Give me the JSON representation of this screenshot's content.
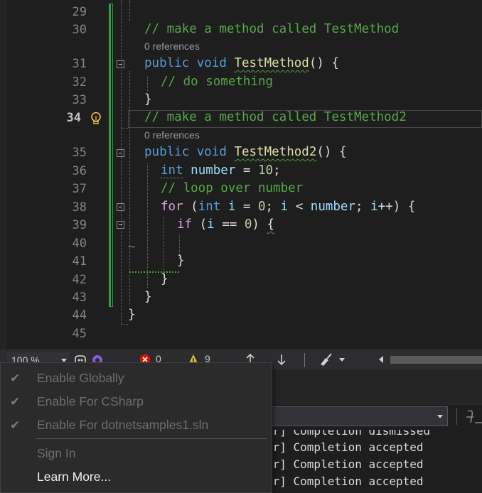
{
  "editor": {
    "line_numbers": [
      "29",
      "30",
      "31",
      "32",
      "33",
      "34",
      "35",
      "36",
      "37",
      "38",
      "39",
      "40",
      "41",
      "42",
      "43",
      "44",
      "45"
    ],
    "active_line": "34",
    "codelens": [
      "0 references",
      "0 references"
    ],
    "lines": {
      "l30": "// make a method called TestMethod",
      "l31_kw1": "public",
      "l31_kw2": "void",
      "l31_method": "TestMethod",
      "l31_rest": "() {",
      "l32": "// do something",
      "l33": "}",
      "l34": "// make a method called TestMethod2",
      "l35_kw1": "public",
      "l35_kw2": "void",
      "l35_method": "TestMethod2",
      "l35_rest": "() {",
      "l36_kw": "int",
      "l36_var": "number",
      "l36_op": " = ",
      "l36_num": "10",
      "l36_end": ";",
      "l37": "// loop over number",
      "l38_kw": "for",
      "l38_a": " (",
      "l38_int": "int",
      "l38_i": "i",
      "l38_b": " = ",
      "l38_zero": "0",
      "l38_c": "; ",
      "l38_i2": "i",
      "l38_d": " < ",
      "l38_number": "number",
      "l38_e": "; ",
      "l38_i3": "i",
      "l38_f": "++) {",
      "l39_kw": "if",
      "l39_a": " (",
      "l39_i": "i",
      "l39_b": " == ",
      "l39_zero": "0",
      "l39_c": ") ",
      "l39_brace": "{",
      "l40_tilde": "~",
      "l41": "}",
      "l42": "}",
      "l43": "}",
      "l44": "}"
    }
  },
  "statusbar": {
    "zoom": "100 %",
    "errors": "0",
    "warnings": "9"
  },
  "output": {
    "lines": [
      "er] Completion dismissed",
      "er] Completion accepted",
      "er] Completion accepted",
      "er] Completion accepted"
    ]
  },
  "context_menu": {
    "items": [
      {
        "label": "Enable Globally",
        "checked": true,
        "enabled": false
      },
      {
        "label": "Enable For CSharp",
        "checked": true,
        "enabled": false
      },
      {
        "label": "Enable For dotnetsamples1.sln",
        "checked": true,
        "enabled": false
      },
      {
        "label": "Sign In",
        "checked": false,
        "enabled": false
      },
      {
        "label": "Learn More...",
        "checked": false,
        "enabled": true
      }
    ]
  },
  "colors": {
    "comment": "#57a64a",
    "keyword": "#569cd6",
    "control_keyword": "#d8a0df",
    "method": "#dcdcaa",
    "variable": "#9cdcfe",
    "number": "#b5cea8",
    "error": "#e51400",
    "warning": "#e8c23a"
  }
}
